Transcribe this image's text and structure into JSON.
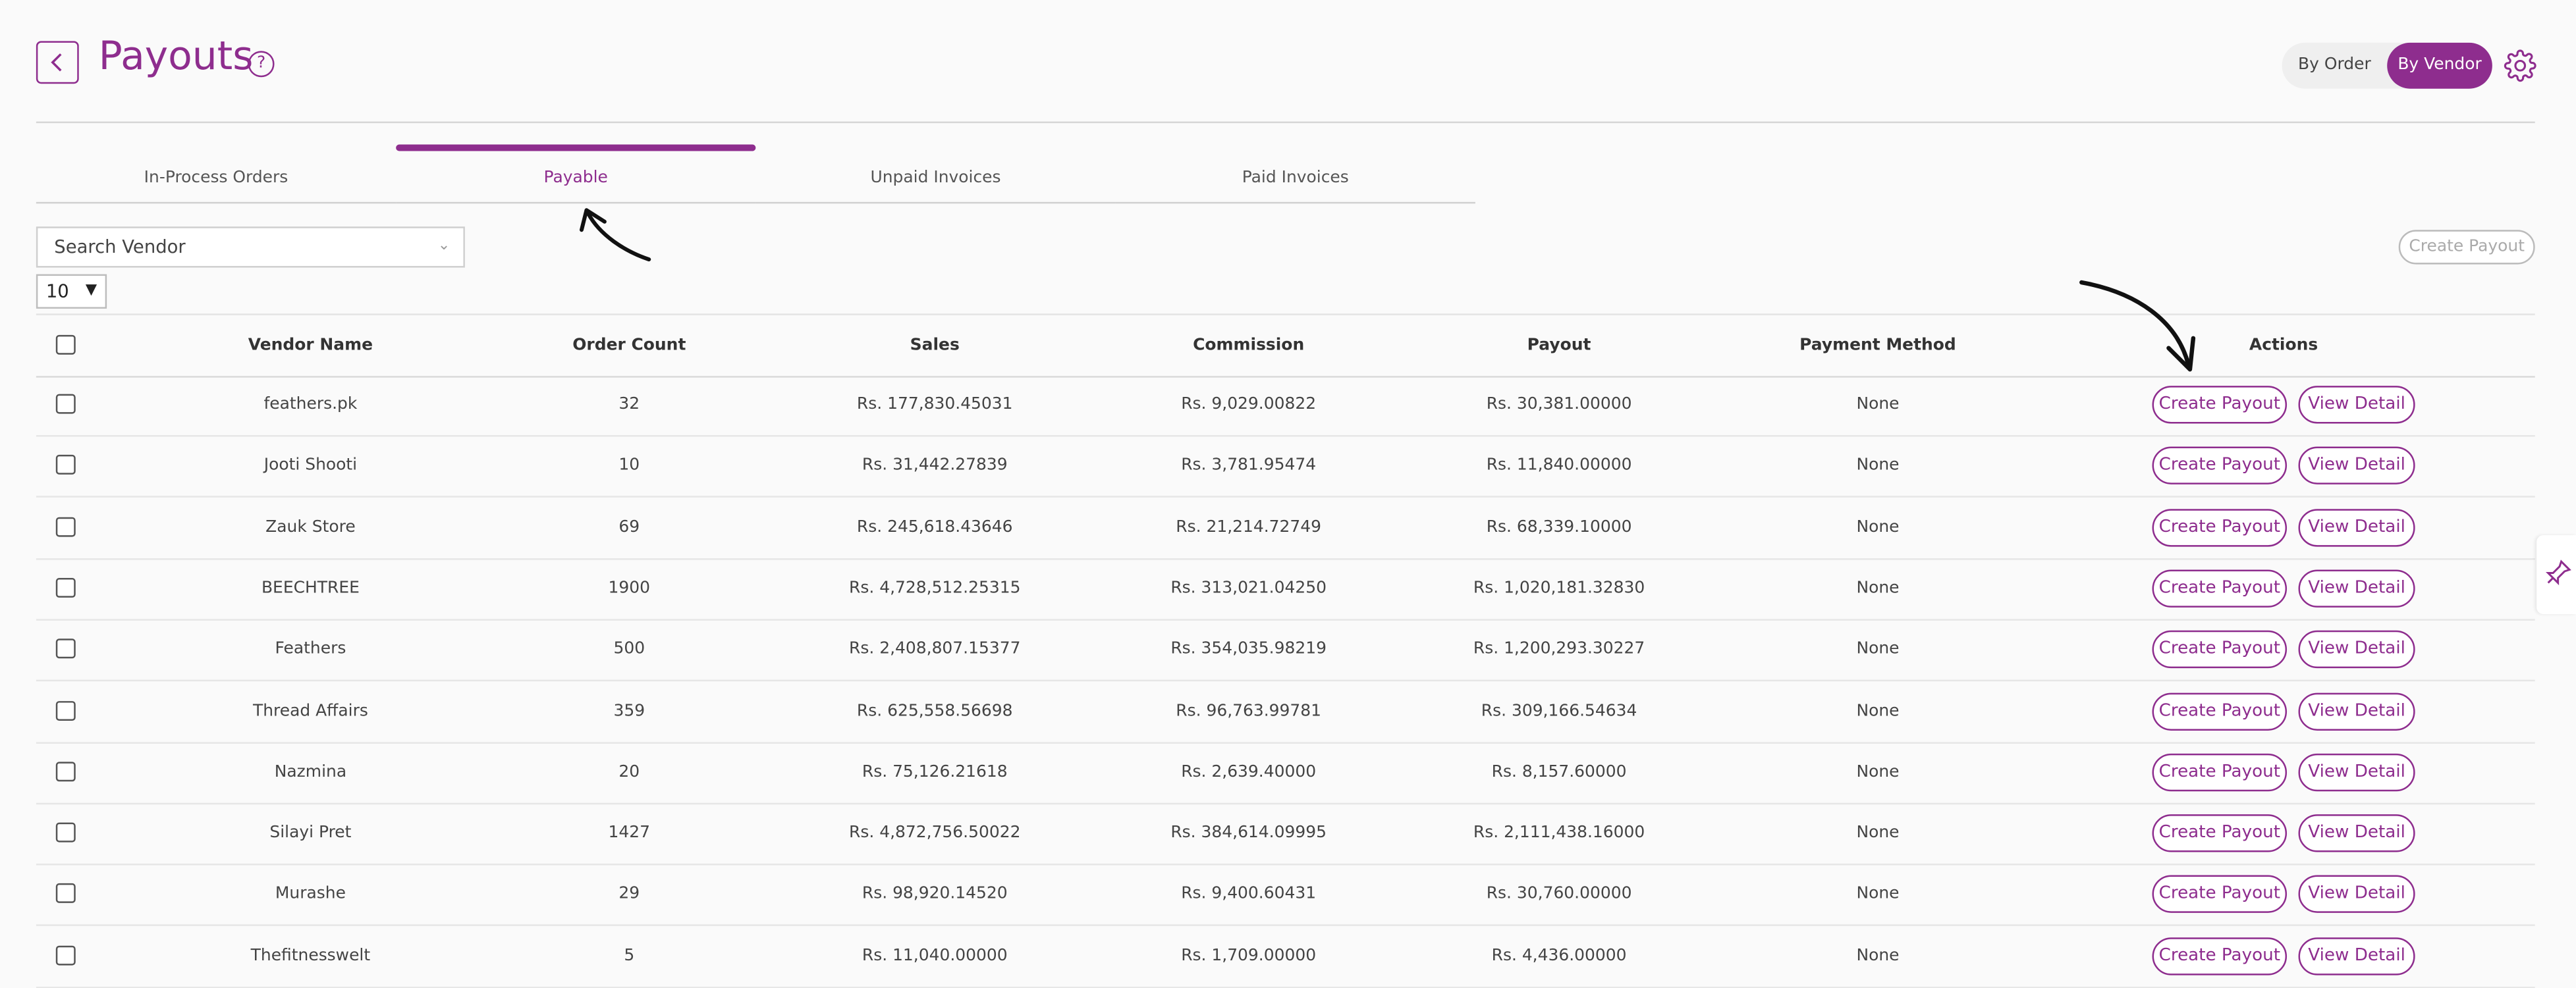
{
  "header": {
    "title": "Payouts",
    "help_symbol": "?",
    "view_toggle": {
      "options": [
        "By Order",
        "By Vendor"
      ],
      "selected": "By Vendor"
    },
    "settings_icon": "gear-icon"
  },
  "tabs": [
    {
      "label": "In-Process Orders",
      "active": false
    },
    {
      "label": "Payable",
      "active": true
    },
    {
      "label": "Unpaid Invoices",
      "active": false
    },
    {
      "label": "Paid Invoices",
      "active": false
    }
  ],
  "search": {
    "placeholder": "Search Vendor"
  },
  "page_size": "10",
  "toolbar": {
    "create_payout_label": "Create Payout"
  },
  "table": {
    "columns": [
      "Vendor Name",
      "Order Count",
      "Sales",
      "Commission",
      "Payout",
      "Payment Method",
      "Actions"
    ],
    "row_actions": [
      "Create Payout",
      "View Detail"
    ],
    "rows": [
      {
        "vendor": "feathers.pk",
        "orders": "32",
        "sales": "Rs. 177,830.45031",
        "commission": "Rs. 9,029.00822",
        "payout": "Rs. 30,381.00000",
        "method": "None"
      },
      {
        "vendor": "Jooti Shooti",
        "orders": "10",
        "sales": "Rs. 31,442.27839",
        "commission": "Rs. 3,781.95474",
        "payout": "Rs. 11,840.00000",
        "method": "None"
      },
      {
        "vendor": "Zauk Store",
        "orders": "69",
        "sales": "Rs. 245,618.43646",
        "commission": "Rs. 21,214.72749",
        "payout": "Rs. 68,339.10000",
        "method": "None"
      },
      {
        "vendor": "BEECHTREE",
        "orders": "1900",
        "sales": "Rs. 4,728,512.25315",
        "commission": "Rs. 313,021.04250",
        "payout": "Rs. 1,020,181.32830",
        "method": "None"
      },
      {
        "vendor": "Feathers",
        "orders": "500",
        "sales": "Rs. 2,408,807.15377",
        "commission": "Rs. 354,035.98219",
        "payout": "Rs. 1,200,293.30227",
        "method": "None"
      },
      {
        "vendor": "Thread Affairs",
        "orders": "359",
        "sales": "Rs. 625,558.56698",
        "commission": "Rs. 96,763.99781",
        "payout": "Rs. 309,166.54634",
        "method": "None"
      },
      {
        "vendor": "Nazmina",
        "orders": "20",
        "sales": "Rs. 75,126.21618",
        "commission": "Rs. 2,639.40000",
        "payout": "Rs. 8,157.60000",
        "method": "None"
      },
      {
        "vendor": "Silayi Pret",
        "orders": "1427",
        "sales": "Rs. 4,872,756.50022",
        "commission": "Rs. 384,614.09995",
        "payout": "Rs. 2,111,438.16000",
        "method": "None"
      },
      {
        "vendor": "Murashe",
        "orders": "29",
        "sales": "Rs. 98,920.14520",
        "commission": "Rs. 9,400.60431",
        "payout": "Rs. 30,760.00000",
        "method": "None"
      },
      {
        "vendor": "Thefitnesswelt",
        "orders": "5",
        "sales": "Rs. 11,040.00000",
        "commission": "Rs. 1,709.00000",
        "payout": "Rs. 4,436.00000",
        "method": "None"
      }
    ]
  },
  "colors": {
    "accent": "#8e2d8e",
    "background": "#fafafa",
    "border": "#d6d6d6"
  }
}
